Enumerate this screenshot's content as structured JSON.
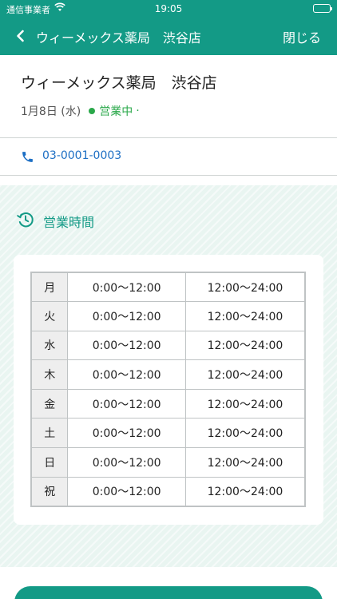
{
  "status_bar": {
    "carrier": "通信事業者",
    "time": "19:05"
  },
  "nav": {
    "title": "ウィーメックス薬局　渋谷店",
    "close_label": "閉じる"
  },
  "store": {
    "name": "ウィーメックス薬局　渋谷店",
    "date": "1月8日 (水)",
    "open_status": "営業中",
    "open_suffix": "·"
  },
  "contact": {
    "phone": "03-0001-0003"
  },
  "hours": {
    "heading": "営業時間",
    "rows": [
      {
        "day": "月",
        "am": "0:00～12:00",
        "pm": "12:00～24:00"
      },
      {
        "day": "火",
        "am": "0:00～12:00",
        "pm": "12:00～24:00"
      },
      {
        "day": "水",
        "am": "0:00～12:00",
        "pm": "12:00～24:00"
      },
      {
        "day": "木",
        "am": "0:00～12:00",
        "pm": "12:00～24:00"
      },
      {
        "day": "金",
        "am": "0:00～12:00",
        "pm": "12:00～24:00"
      },
      {
        "day": "土",
        "am": "0:00～12:00",
        "pm": "12:00～24:00"
      },
      {
        "day": "日",
        "am": "0:00～12:00",
        "pm": "12:00～24:00"
      },
      {
        "day": "祝",
        "am": "0:00～12:00",
        "pm": "12:00～24:00"
      }
    ]
  },
  "colors": {
    "brand": "#139a86",
    "open_green": "#2aa84a",
    "link_blue": "#1d6fc4"
  },
  "icons": {
    "back": "chevron-left-icon",
    "phone": "phone-icon",
    "hours": "history-icon",
    "wifi": "wifi-icon",
    "battery": "battery-icon"
  }
}
